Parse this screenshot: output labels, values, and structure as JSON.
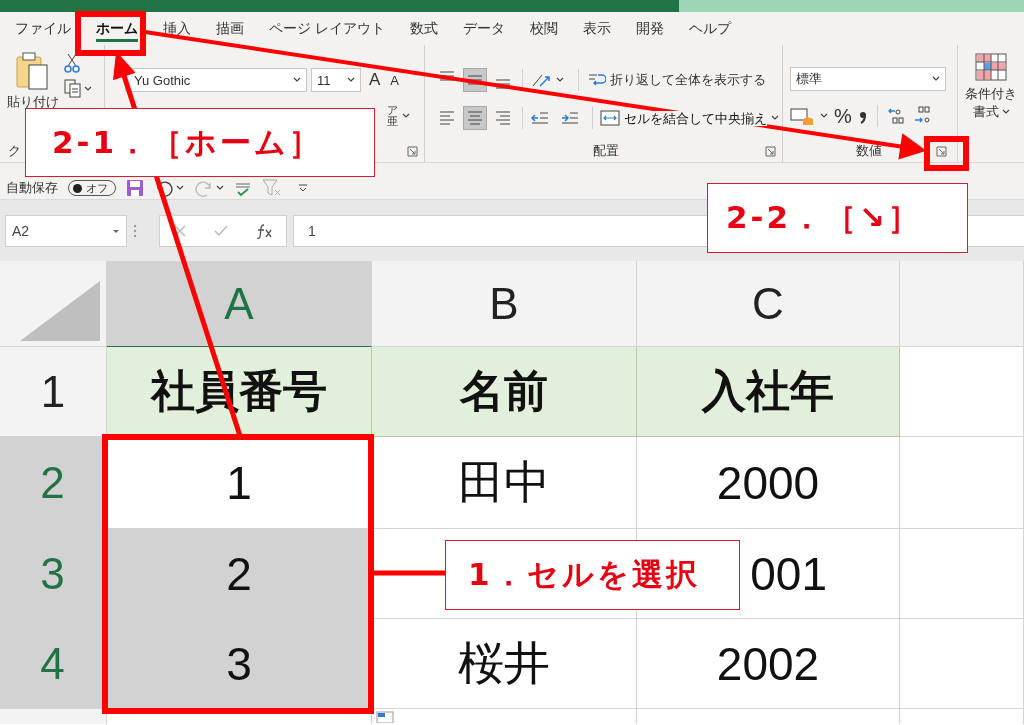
{
  "tabs": [
    {
      "label": "ファイル",
      "selected": false
    },
    {
      "label": "ホーム",
      "selected": true
    },
    {
      "label": "挿入",
      "selected": false
    },
    {
      "label": "描画",
      "selected": false
    },
    {
      "label": "ページ レイアウト",
      "selected": false
    },
    {
      "label": "数式",
      "selected": false
    },
    {
      "label": "データ",
      "selected": false
    },
    {
      "label": "校閲",
      "selected": false
    },
    {
      "label": "表示",
      "selected": false
    },
    {
      "label": "開発",
      "selected": false
    },
    {
      "label": "ヘルプ",
      "selected": false
    }
  ],
  "ribbon": {
    "clipboard": {
      "paste_label": "貼り付け",
      "group_label": "ク"
    },
    "font": {
      "font_name": "Yu Gothic",
      "font_size": "11",
      "grow": "A",
      "shrink": "A",
      "phonetic": "ア亜"
    },
    "alignment": {
      "vertical": [
        {
          "kind": "top",
          "selected": false
        },
        {
          "kind": "middle",
          "selected": true
        },
        {
          "kind": "bottom",
          "selected": false
        }
      ],
      "horizontal": [
        {
          "kind": "left",
          "selected": false
        },
        {
          "kind": "center",
          "selected": true
        },
        {
          "kind": "right",
          "selected": false
        }
      ],
      "wrap_text": "折り返して全体を表示する",
      "merge": "セルを結合して中央揃え",
      "group_label": "配置"
    },
    "number": {
      "format": "標準",
      "percent": "%",
      "group_label": "数値"
    },
    "styles": {
      "conditional_lines": [
        "条件付き",
        "書式"
      ]
    }
  },
  "quick_access": {
    "autosave_label": "自動保存",
    "autosave_on": false,
    "autosave_state": "オフ"
  },
  "formula_bar": {
    "name_box": "A2",
    "value": "1"
  },
  "sheet": {
    "columns": [
      {
        "label": "A",
        "selected": true
      },
      {
        "label": "B",
        "selected": false
      },
      {
        "label": "C",
        "selected": false
      },
      {
        "selected": false
      }
    ],
    "rows": [
      {
        "header": "1",
        "selected": false,
        "cells": [
          {
            "text": "社員番号",
            "kind": "heading",
            "selected": false
          },
          {
            "text": "名前",
            "kind": "heading",
            "selected": false
          },
          {
            "text": "入社年",
            "kind": "heading",
            "selected": false
          },
          {
            "kind": "value",
            "selected": false
          }
        ]
      },
      {
        "header": "2",
        "selected": true,
        "cells": [
          {
            "text": "1",
            "kind": "value",
            "selected": false
          },
          {
            "text": "田中",
            "kind": "value",
            "selected": false
          },
          {
            "text": "2000",
            "kind": "value",
            "selected": false
          },
          {
            "kind": "value",
            "selected": false
          }
        ]
      },
      {
        "header": "3",
        "selected": true,
        "cells": [
          {
            "text": "2",
            "kind": "value",
            "selected": true
          },
          {
            "kind": "value",
            "selected": false
          },
          {
            "text": "001",
            "kind": "value",
            "selected": false,
            "covered": true
          },
          {
            "kind": "value",
            "selected": false
          }
        ]
      },
      {
        "header": "4",
        "selected": true,
        "cells": [
          {
            "text": "3",
            "kind": "value",
            "selected": true
          },
          {
            "text": "桜井",
            "kind": "value",
            "selected": false
          },
          {
            "text": "2002",
            "kind": "value",
            "selected": false
          },
          {
            "kind": "value",
            "selected": false
          }
        ]
      }
    ]
  },
  "annotations": [
    {
      "kind": "home",
      "text": "2-1．［ホーム］"
    },
    {
      "kind": "launcher",
      "text": "2-2．［↘］"
    },
    {
      "kind": "select",
      "text": "1．セルを選択"
    }
  ]
}
